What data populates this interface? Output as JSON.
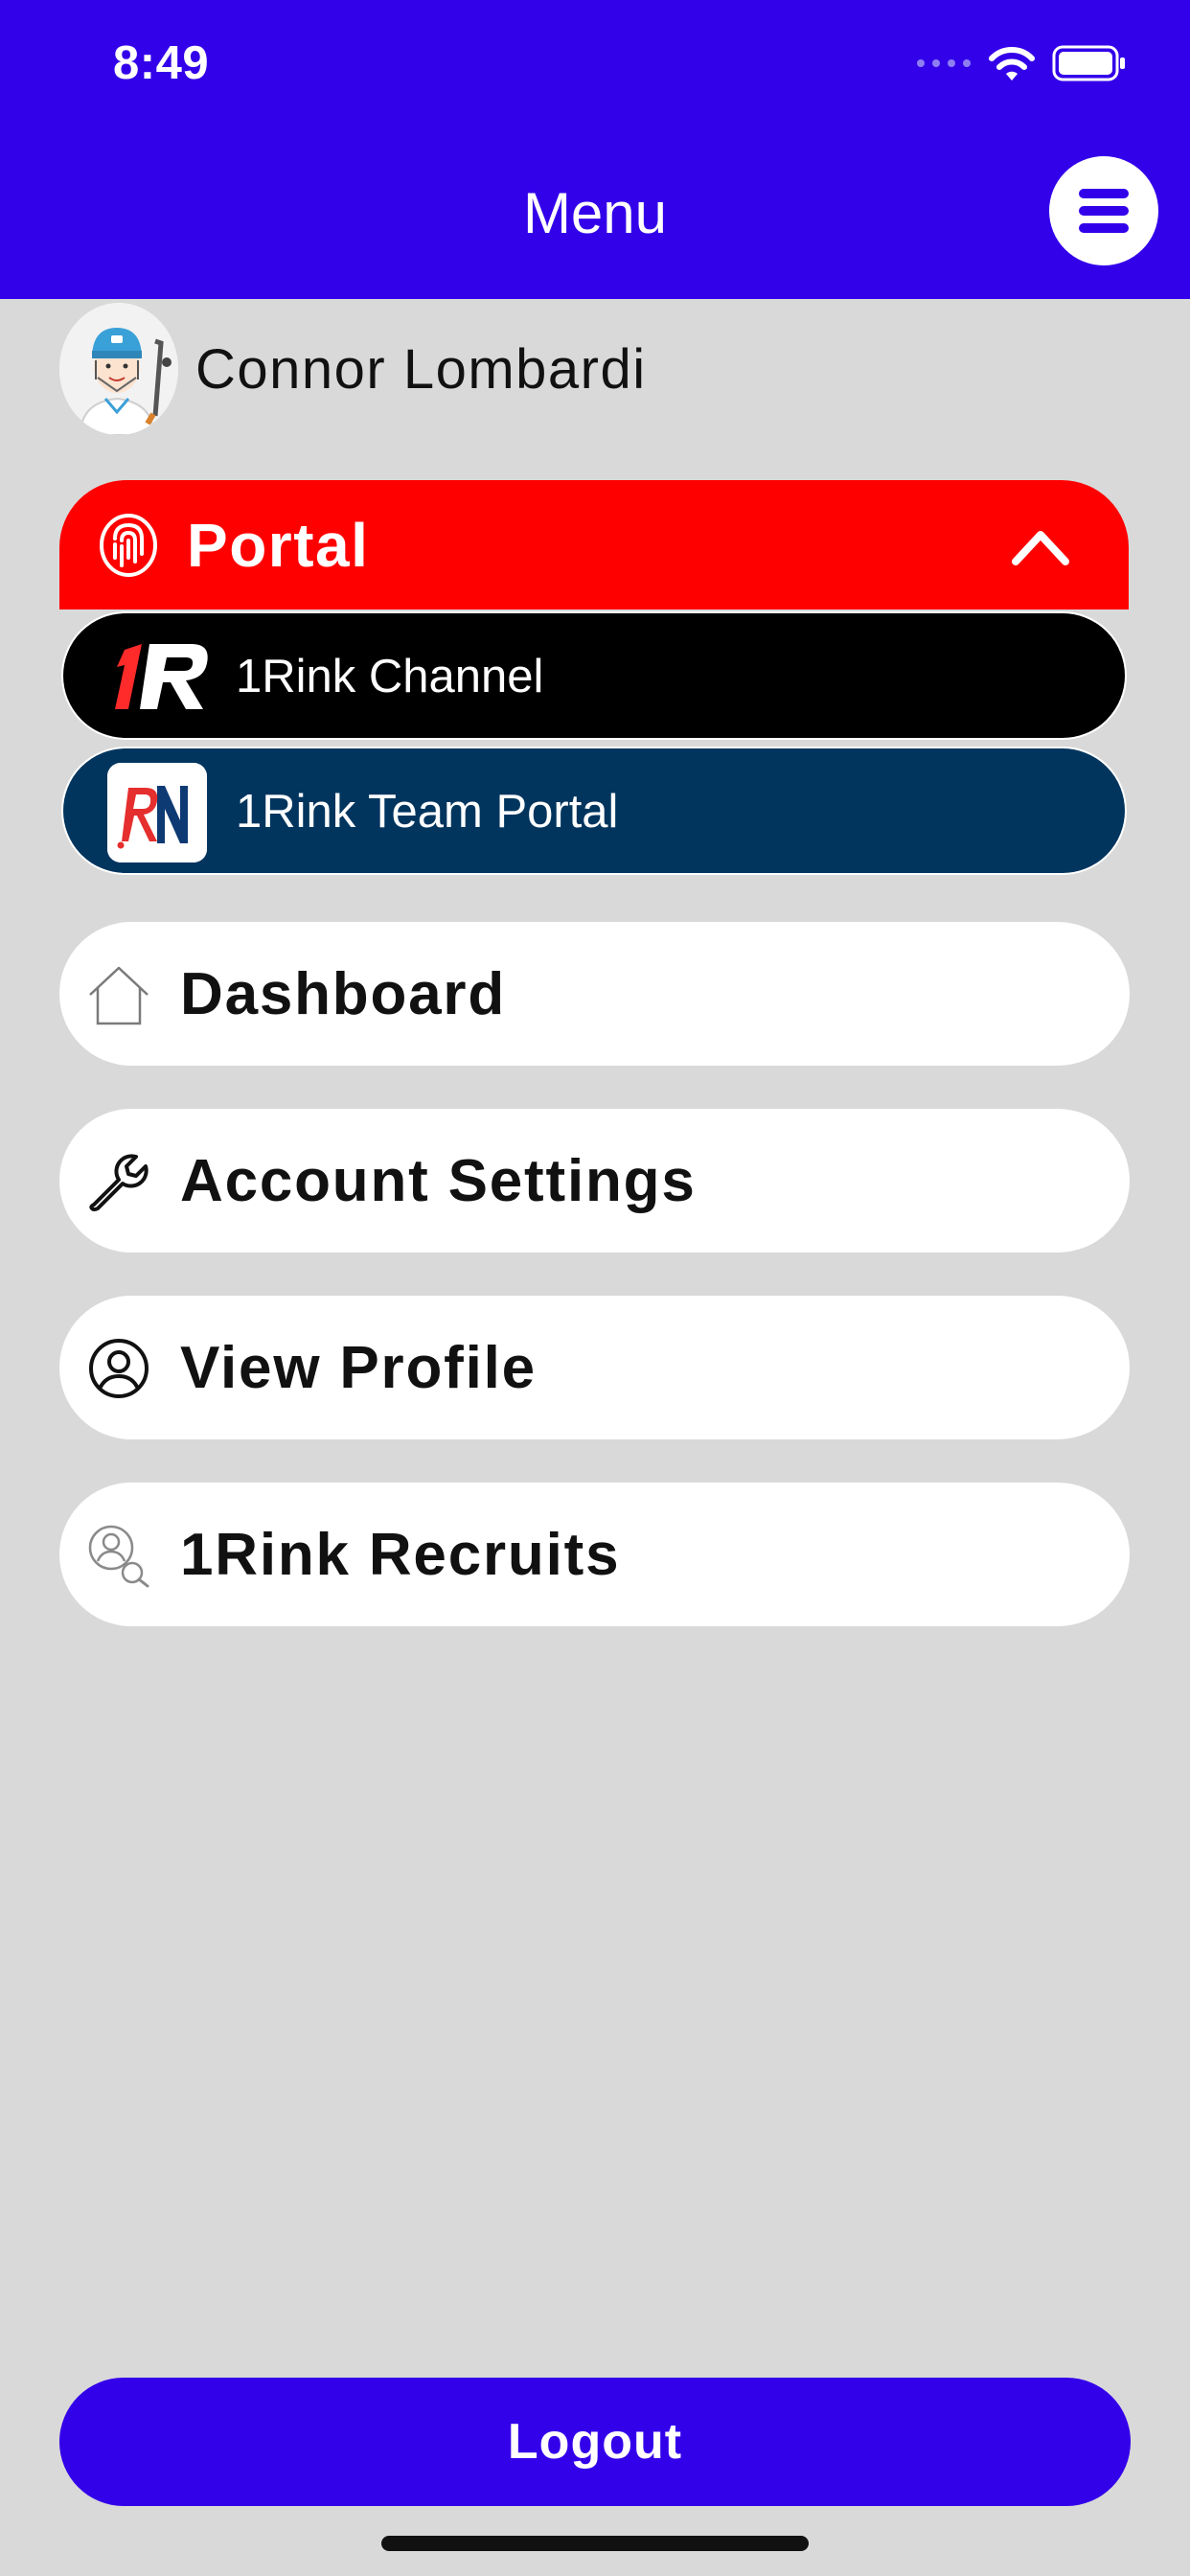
{
  "status_bar": {
    "time": "8:49",
    "icons": [
      "signal-dots-icon",
      "wifi-icon",
      "battery-icon"
    ]
  },
  "header": {
    "title": "Menu",
    "menu_icon": "hamburger-icon",
    "background": "#3300ea"
  },
  "profile": {
    "name": "Connor Lombardi",
    "avatar_icon": "hockey-player-avatar"
  },
  "portal": {
    "label": "Portal",
    "icon": "fingerprint-icon",
    "expanded": true,
    "color": "#ff0000",
    "items": [
      {
        "label": "1Rink Channel",
        "icon": "1rink-logo-icon",
        "color": "#000000"
      },
      {
        "label": "1Rink Team Portal",
        "icon": "rn-logo-icon",
        "color": "#01355e"
      }
    ]
  },
  "menu": {
    "items": [
      {
        "label": "Dashboard",
        "icon": "home-icon"
      },
      {
        "label": "Account Settings",
        "icon": "wrench-icon"
      },
      {
        "label": "View Profile",
        "icon": "user-circle-icon"
      },
      {
        "label": "1Rink Recruits",
        "icon": "user-search-icon"
      }
    ]
  },
  "logout": {
    "label": "Logout",
    "color": "#3300ea"
  }
}
